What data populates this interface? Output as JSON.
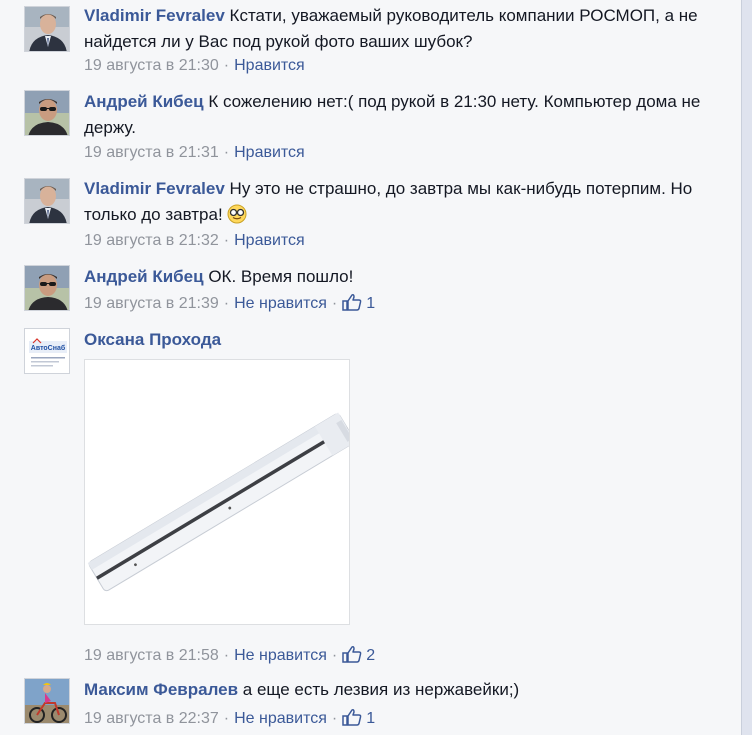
{
  "comments": [
    {
      "author": "Vladimir Fevralev",
      "text": "Кстати, уважаемый руководитель компании РОСМОП, а не найдется ли у Вас под рукой фото ваших шубок?",
      "timestamp": "19 августа в 21:30",
      "like_label": "Нравится",
      "avatar_icon": "avatar-man-suit-icon"
    },
    {
      "author": "Андрей Кибец",
      "text": "К сожелению нет:( под рукой в 21:30 нету. Компьютер дома не держу.",
      "timestamp": "19 августа в 21:31",
      "like_label": "Нравится",
      "avatar_icon": "avatar-man-sunglasses-icon"
    },
    {
      "author": "Vladimir Fevralev",
      "text": "Ну это не страшно, до завтра мы как-нибудь потерпим. Но только до завтра!",
      "timestamp": "19 августа в 21:32",
      "like_label": "Нравится",
      "avatar_icon": "avatar-man-suit-icon",
      "emoji_icon": "sunglasses-emoji-icon"
    },
    {
      "author": "Андрей Кибец",
      "text": "ОК. Время пошло!",
      "timestamp": "19 августа в 21:39",
      "like_label": "Не нравится",
      "like_count": "1",
      "avatar_icon": "avatar-man-sunglasses-icon"
    },
    {
      "author": "Оксана Прохода",
      "text": "",
      "timestamp": "19 августа в 21:58",
      "like_label": "Не нравится",
      "like_count": "2",
      "avatar_icon": "avtosnab-logo-icon",
      "avatar_logo_text": "АвтоСнаб",
      "photo_icon": "white-bar-photo-icon"
    },
    {
      "author": "Максим Февралев",
      "text": "а еще есть лезвия из нержавейки;)",
      "timestamp": "19 августа в 22:37",
      "like_label": "Не нравится",
      "like_count": "1",
      "avatar_icon": "avatar-cyclist-icon"
    }
  ],
  "colors": {
    "link": "#3b5998",
    "meta": "#90949c",
    "text": "#141823",
    "background": "#f6f7f9"
  }
}
